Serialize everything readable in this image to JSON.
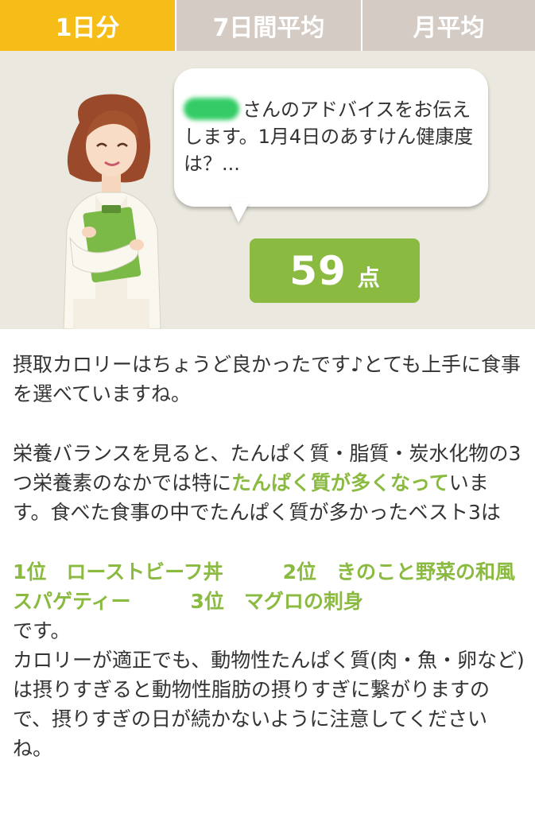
{
  "tabs": [
    {
      "label": "1日分",
      "active": true
    },
    {
      "label": "7日間平均",
      "active": false
    },
    {
      "label": "月平均",
      "active": false
    }
  ],
  "advice": {
    "name_blurred": true,
    "bubble_text": "さんのアドバイスをお伝えします。1月4日のあすけん健康度は？..."
  },
  "score": {
    "value": "59",
    "unit": "点"
  },
  "body": {
    "p1": "摂取カロリーはちょうど良かったです♪とても上手に食事を選べていますね。",
    "p2_before": "栄養バランスを見ると、たんぱく質・脂質・炭水化物の3つ栄養素のなかでは特に",
    "p2_highlight": "たんぱく質が多くなって",
    "p2_after": "います。食べた食事の中でたんぱく質が多かったベスト3は",
    "top3": "1位　ローストビーフ丼　　　2位　きのこと野菜の和風スパゲティー　　　3位　マグロの刺身",
    "p3": "です。",
    "p4": "カロリーが適正でも、動物性たんぱく質(肉・魚・卵など)は摂りすぎると動物性脂肪の摂りすぎに繋がりますので、摂りすぎの日が続かないように注意してくださいね。"
  },
  "colors": {
    "tab_active": "#f6bd19",
    "tab_inactive": "#d3cbc4",
    "accent_green": "#8aba40",
    "hero_bg": "#ebe9df"
  }
}
